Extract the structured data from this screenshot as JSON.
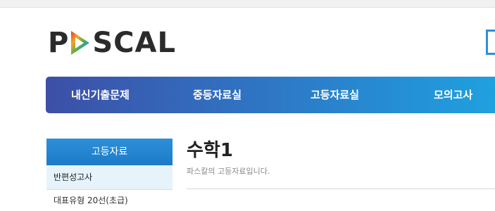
{
  "header": {
    "logo_prefix": "P",
    "logo_suffix": "SCAL",
    "logo_text": "PASCAL"
  },
  "nav": {
    "items": [
      {
        "label": "내신기출문제"
      },
      {
        "label": "중등자료실"
      },
      {
        "label": "고등자료실"
      },
      {
        "label": "모의고사"
      }
    ]
  },
  "sidebar": {
    "title": "고등자료",
    "items": [
      {
        "label": "반편성고사"
      },
      {
        "label": "대표유형 20선(초급)"
      }
    ]
  },
  "main": {
    "title": "수학1",
    "subtitle": "파스칼의 고등자료입니다."
  }
}
